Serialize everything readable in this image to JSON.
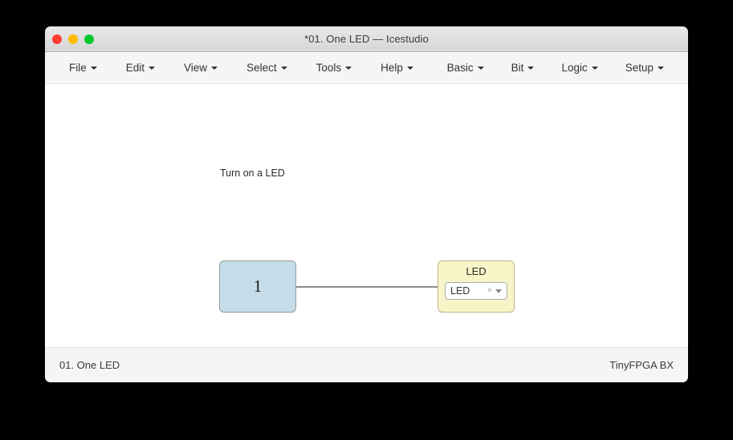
{
  "window": {
    "title": "*01. One LED — Icestudio",
    "traffic_lights": [
      {
        "name": "close",
        "color": "#ff3b30"
      },
      {
        "name": "minimize",
        "color": "#ffbd00"
      },
      {
        "name": "zoom",
        "color": "#00ca2c"
      }
    ]
  },
  "menubar": {
    "left_items": [
      {
        "label": "File"
      },
      {
        "label": "Edit"
      },
      {
        "label": "View"
      },
      {
        "label": "Select"
      },
      {
        "label": "Tools"
      },
      {
        "label": "Help"
      }
    ],
    "right_items": [
      {
        "label": "Basic"
      },
      {
        "label": "Bit"
      },
      {
        "label": "Logic"
      },
      {
        "label": "Setup"
      }
    ]
  },
  "canvas": {
    "note": "Turn on a LED",
    "constant_block": {
      "value": "1",
      "fill": "#c4dde8",
      "border": "#9a9a9a"
    },
    "led_block": {
      "title": "LED",
      "fill": "#f7f4c8",
      "border": "#b9b590",
      "select": {
        "value": "LED",
        "clear_glyph": "×",
        "caret_icon": "chevron-down-icon"
      }
    },
    "wire": {
      "color": "#8c8c8c"
    }
  },
  "statusbar": {
    "project": "01. One LED",
    "board": "TinyFPGA BX"
  }
}
